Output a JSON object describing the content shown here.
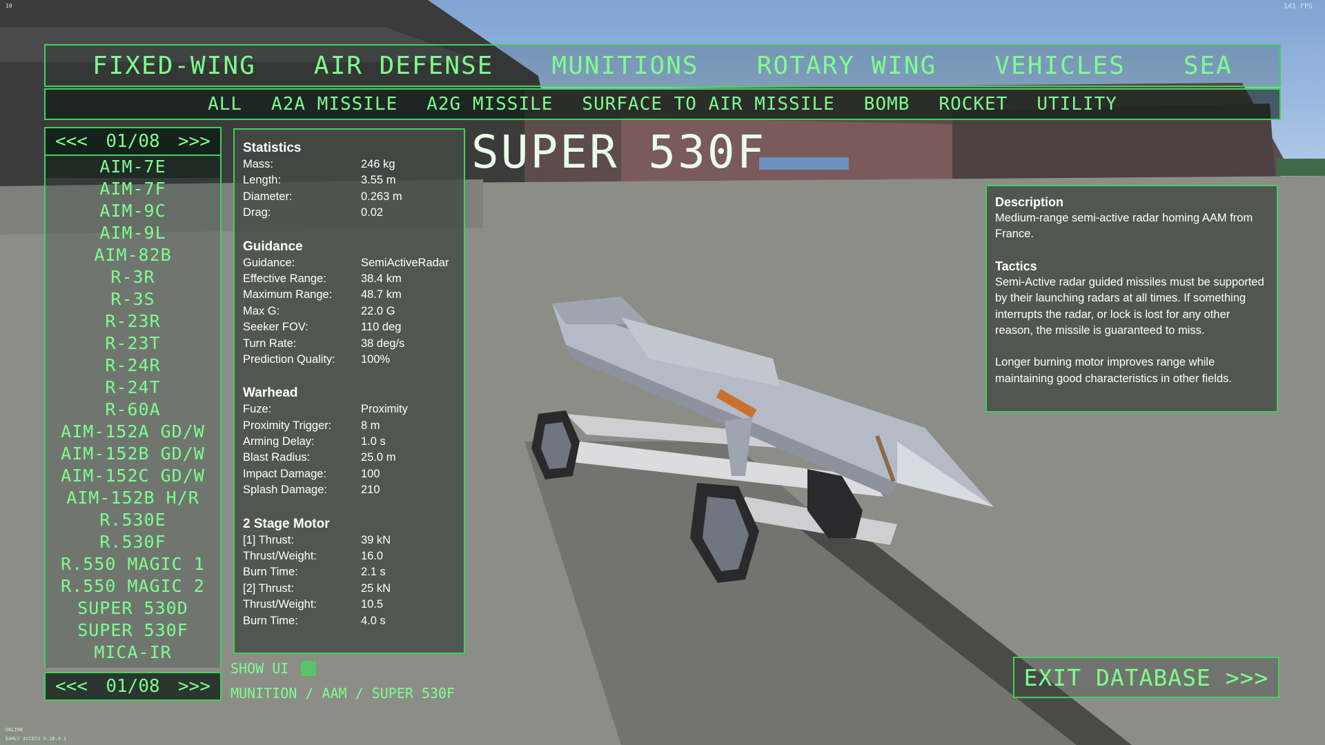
{
  "hud": {
    "fps": "141 FPS",
    "corner": "10",
    "status_online": "ONLINE",
    "build": "EARLY ACCESS 0.18.0.1"
  },
  "categories": [
    "FIXED-WING",
    "AIR DEFENSE",
    "MUNITIONS",
    "ROTARY WING",
    "VEHICLES",
    "SEA"
  ],
  "subcategories": [
    "ALL",
    "A2A MISSILE",
    "A2G MISSILE",
    "SURFACE TO AIR MISSILE",
    "BOMB",
    "ROCKET",
    "UTILITY"
  ],
  "pager": {
    "prev": "<<<",
    "page": "01/08",
    "next": ">>>"
  },
  "list": {
    "items": [
      "AIM-7E",
      "AIM-7F",
      "AIM-9C",
      "AIM-9L",
      "AIM-82B",
      "R-3R",
      "R-3S",
      "R-23R",
      "R-23T",
      "R-24R",
      "R-24T",
      "R-60A",
      "AIM-152A GD/W",
      "AIM-152B GD/W",
      "AIM-152C GD/W",
      "AIM-152B H/R",
      "R.530E",
      "R.530F",
      "R.550 MAGIC 1",
      "R.550 MAGIC 2",
      "SUPER 530D",
      "SUPER 530F",
      "MICA-IR"
    ],
    "selected": "AIM-7E"
  },
  "title": "SUPER 530F",
  "stats": {
    "statistics": {
      "title": "Statistics",
      "rows": [
        [
          "Mass:",
          "246 kg"
        ],
        [
          "Length:",
          "3.55 m"
        ],
        [
          "Diameter:",
          "0.263 m"
        ],
        [
          "Drag:",
          "0.02"
        ]
      ]
    },
    "guidance": {
      "title": "Guidance",
      "rows": [
        [
          "Guidance:",
          "SemiActiveRadar"
        ],
        [
          "Effective Range:",
          "38.4 km"
        ],
        [
          "Maximum Range:",
          "48.7 km"
        ],
        [
          "Max G:",
          "22.0 G"
        ],
        [
          "Seeker FOV:",
          "110 deg"
        ],
        [
          "Turn Rate:",
          "38 deg/s"
        ],
        [
          "Prediction Quality:",
          "100%"
        ]
      ]
    },
    "warhead": {
      "title": "Warhead",
      "rows": [
        [
          "Fuze:",
          "Proximity"
        ],
        [
          "Proximity Trigger:",
          "8 m"
        ],
        [
          "Arming Delay:",
          "1.0 s"
        ],
        [
          "Blast Radius:",
          "25.0 m"
        ],
        [
          "Impact Damage:",
          "100"
        ],
        [
          "Splash Damage:",
          "210"
        ]
      ]
    },
    "motor": {
      "title": "2 Stage Motor",
      "rows": [
        [
          "[1] Thrust:",
          "39 kN"
        ],
        [
          "Thrust/Weight:",
          "16.0"
        ],
        [
          "Burn Time:",
          "2.1 s"
        ],
        [
          "[2] Thrust:",
          "25 kN"
        ],
        [
          "Thrust/Weight:",
          "10.5"
        ],
        [
          "Burn Time:",
          "4.0 s"
        ]
      ]
    }
  },
  "description": {
    "title": "Description",
    "text": "Medium-range semi-active radar homing AAM from France.",
    "tactics_title": "Tactics",
    "tactics_text": "Semi-Active radar guided missiles must be supported by their launching radars at all times. If something interrupts the radar, or lock is lost for any other reason, the missile is guaranteed to miss.",
    "extra_text": "Longer burning motor improves range while maintaining good characteristics in other fields."
  },
  "show_ui": {
    "label": "SHOW UI",
    "checked": true
  },
  "breadcrumb": "MUNITION / AAM / SUPER 530F",
  "exit_label": "EXIT DATABASE >>>",
  "colors": {
    "accent": "#3fd35a",
    "text_green": "#7dff8e",
    "panel": "#464b46"
  }
}
